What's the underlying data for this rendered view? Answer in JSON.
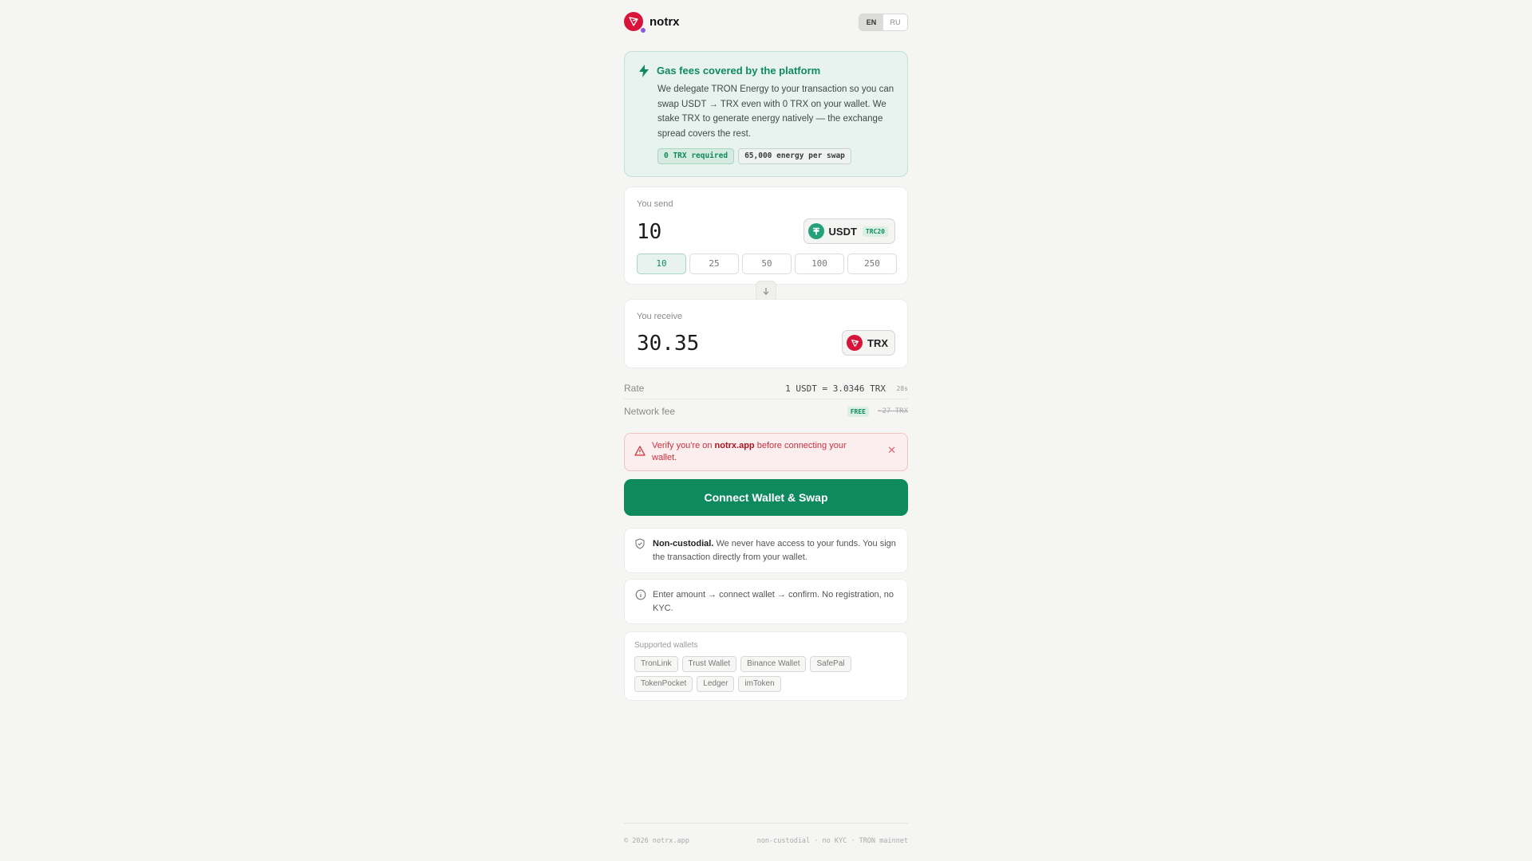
{
  "brand": {
    "name": "notrx"
  },
  "lang": {
    "en": "EN",
    "ru": "RU",
    "active": "EN"
  },
  "gas": {
    "title": "Gas fees covered by the platform",
    "text": "We delegate TRON Energy to your transaction so you can swap USDT → TRX even with 0 TRX on your wallet. We stake TRX to generate energy natively — the exchange spread covers the rest.",
    "tag_required": "0 TRX required",
    "tag_energy": "65,000 energy per swap"
  },
  "send": {
    "label": "You send",
    "amount": "10",
    "token": "USDT",
    "network": "TRC20",
    "presets": [
      "10",
      "25",
      "50",
      "100",
      "250"
    ],
    "active_preset": "10"
  },
  "receive": {
    "label": "You receive",
    "amount": "30.35",
    "token": "TRX"
  },
  "rate": {
    "label": "Rate",
    "value": "1 USDT = 3.0346 TRX",
    "timer": "28s"
  },
  "fee": {
    "label": "Network fee",
    "badge": "FREE",
    "old": "~27 TRX"
  },
  "warning": {
    "prefix": "Verify you're on ",
    "domain": "notrx.app",
    "suffix": " before connecting your wallet."
  },
  "cta": {
    "label": "Connect Wallet & Swap"
  },
  "info1": {
    "bold": "Non-custodial.",
    "text": " We never have access to your funds. You sign the transaction directly from your wallet."
  },
  "info2": {
    "text": "Enter amount → connect wallet → confirm. No registration, no KYC."
  },
  "wallets": {
    "label": "Supported wallets",
    "items": [
      "TronLink",
      "Trust Wallet",
      "Binance Wallet",
      "SafePal",
      "TokenPocket",
      "Ledger",
      "imToken"
    ]
  },
  "footer": {
    "left": "© 2026 notrx.app",
    "right": "non-custodial · no KYC · TRON mainnet"
  },
  "colors": {
    "accent": "#0f8a5f",
    "brand": "#d9143a",
    "danger": "#d22f3b",
    "tether": "#26a17b"
  }
}
